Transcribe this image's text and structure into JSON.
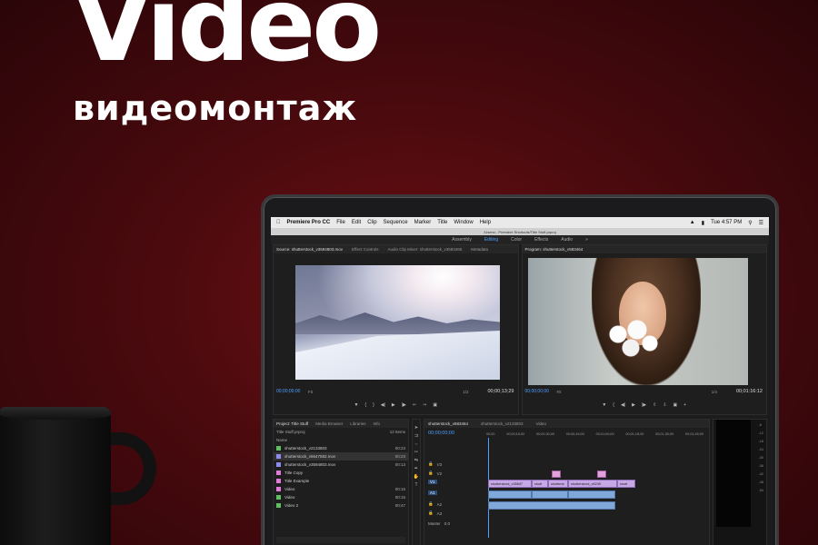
{
  "hero": {
    "title": "Video",
    "subtitle": "видеомонтаж"
  },
  "menubar": {
    "app": "Premiere Pro CC",
    "items": [
      "File",
      "Edit",
      "Clip",
      "Sequence",
      "Marker",
      "Title",
      "Window",
      "Help"
    ],
    "clock": "Tue 4:57 PM"
  },
  "titlebar": {
    "path": "/Users/...Premiere Shortcuts/Title Stuff.prproj"
  },
  "workspaces": {
    "items": [
      "Assembly",
      "Editing",
      "Color",
      "Effects",
      "Audio"
    ],
    "active": "Editing"
  },
  "source_monitor": {
    "tabs": [
      "Source: shutterstock_v3594803.mov",
      "Effect Controls",
      "Audio Clip Mixer: shutterstock_v3583466",
      "Metadata"
    ],
    "timecode": "00;00;00;00",
    "fit": "Fit",
    "zoom": "1/2",
    "duration": "00;00;13;29"
  },
  "program_monitor": {
    "tabs": [
      "Program: shutterstock_v583464"
    ],
    "timecode": "00;00;00;00",
    "fit": "Fit",
    "zoom": "1/4",
    "duration": "00;01:16:12"
  },
  "project": {
    "tabs": [
      "Project: Title Stuff",
      "Media Browser",
      "Libraries",
      "Info"
    ],
    "file": "Title Stuff.prproj",
    "count": "12 Items",
    "col_name": "Name",
    "items": [
      {
        "name": "shutterstock_v2133803",
        "duration": "00:23",
        "color": "#5fbf5f"
      },
      {
        "name": "shutterstock_v5647582.mov",
        "duration": "00:23",
        "color": "#8c8cf0",
        "selected": true
      },
      {
        "name": "shutterstock_v3594803.mov",
        "duration": "00:13",
        "color": "#8c8cf0"
      },
      {
        "name": "Title Copy",
        "duration": "",
        "color": "#e07ad8"
      },
      {
        "name": "Title Example",
        "duration": "",
        "color": "#e07ad8"
      },
      {
        "name": "Video",
        "duration": "00:15",
        "color": "#e07ad8"
      },
      {
        "name": "Video",
        "duration": "00:15",
        "color": "#5fbf5f"
      },
      {
        "name": "Video 2",
        "duration": "00:47",
        "color": "#5fbf5f"
      }
    ]
  },
  "timeline": {
    "tabs": [
      "shutterstock_v583464",
      "shutterstock_v2133803",
      "Video"
    ],
    "timecode": "00;00;00;00",
    "ruler": [
      "00;00",
      "00;00;15;00",
      "00;00;30;00",
      "00;00;45;00",
      "00;01;00;00",
      "00;01;15;00",
      "00;01;30;00",
      "00;01;45;00"
    ],
    "tracks": [
      "V3",
      "V2",
      "V1",
      "A1",
      "A2",
      "A3"
    ],
    "master": "Master",
    "master_value": "0.0",
    "clips": {
      "v1": [
        "shutterstock_v35847",
        "shutt",
        "shutterst",
        "shutterstock_v6239",
        "shutt"
      ]
    }
  },
  "colors": {
    "accent": "#4f9fff",
    "background": "#4a0a0e",
    "video_clip": "#c6a8e6",
    "audio_clip": "#80a8d8",
    "title_clip": "#e2a0dc"
  }
}
